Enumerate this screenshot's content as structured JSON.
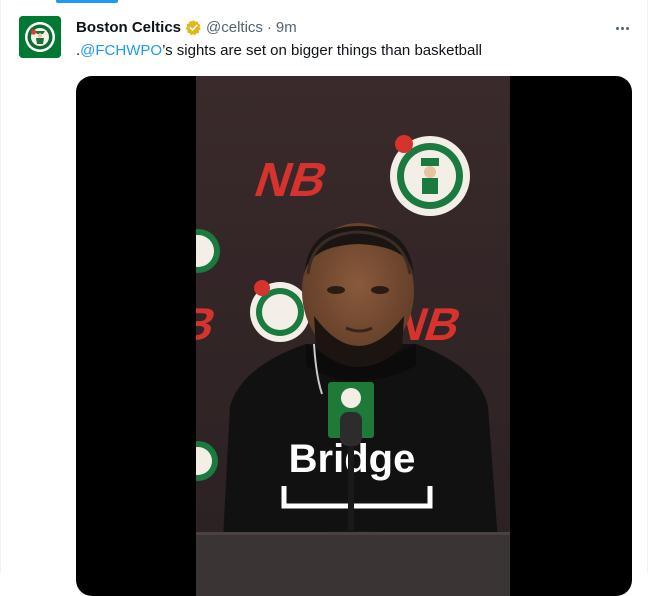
{
  "tweet": {
    "author_name": "Boston Celtics",
    "handle": "@celtics",
    "separator": "·",
    "time": "9m",
    "text_prefix": ".",
    "mention": "@FCHWPO",
    "text_suffix": "’s sights are set on bigger things than basketball"
  },
  "media": {
    "backdrop_logo_text": "NB",
    "shirt_text": "Bridge"
  },
  "icons": {
    "avatar": "celtics-logo-icon",
    "verified": "verified-gold-badge-icon",
    "more": "more-horizontal-icon"
  },
  "colors": {
    "accent": "#1d9bf0",
    "brand_green": "#007a33",
    "verified_gold": "#e2b719",
    "text_secondary": "#536471"
  }
}
